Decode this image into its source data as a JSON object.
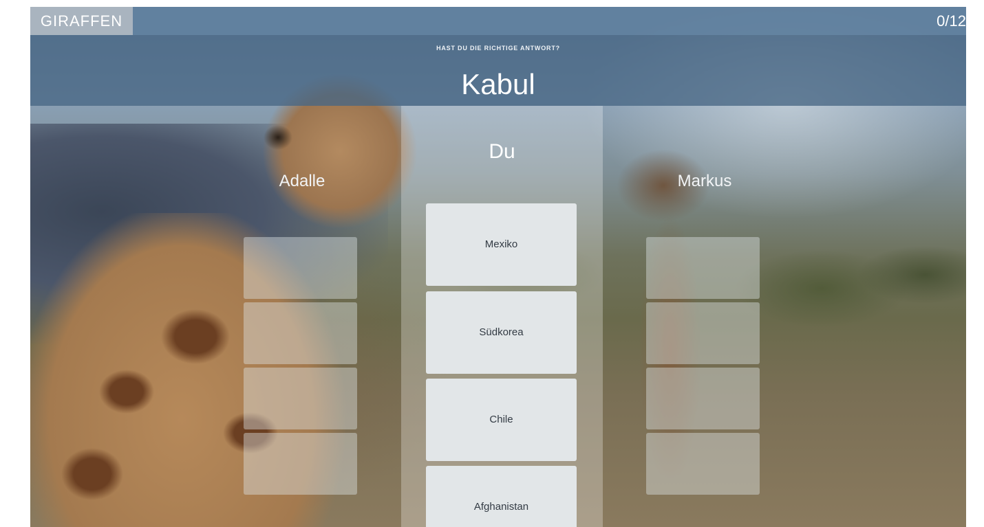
{
  "header": {
    "subject": "GIRAFFEN",
    "progress": "0/12"
  },
  "question": {
    "prompt": "HAST DU DIE RICHTIGE ANTWORT?",
    "text": "Kabul"
  },
  "players": {
    "left": {
      "name": "Adalle",
      "slots": 4
    },
    "center": {
      "name": "Du"
    },
    "right": {
      "name": "Markus",
      "slots": 4
    }
  },
  "answers": [
    {
      "label": "Mexiko"
    },
    {
      "label": "Südkorea"
    },
    {
      "label": "Chile"
    },
    {
      "label": "Afghanistan"
    }
  ]
}
